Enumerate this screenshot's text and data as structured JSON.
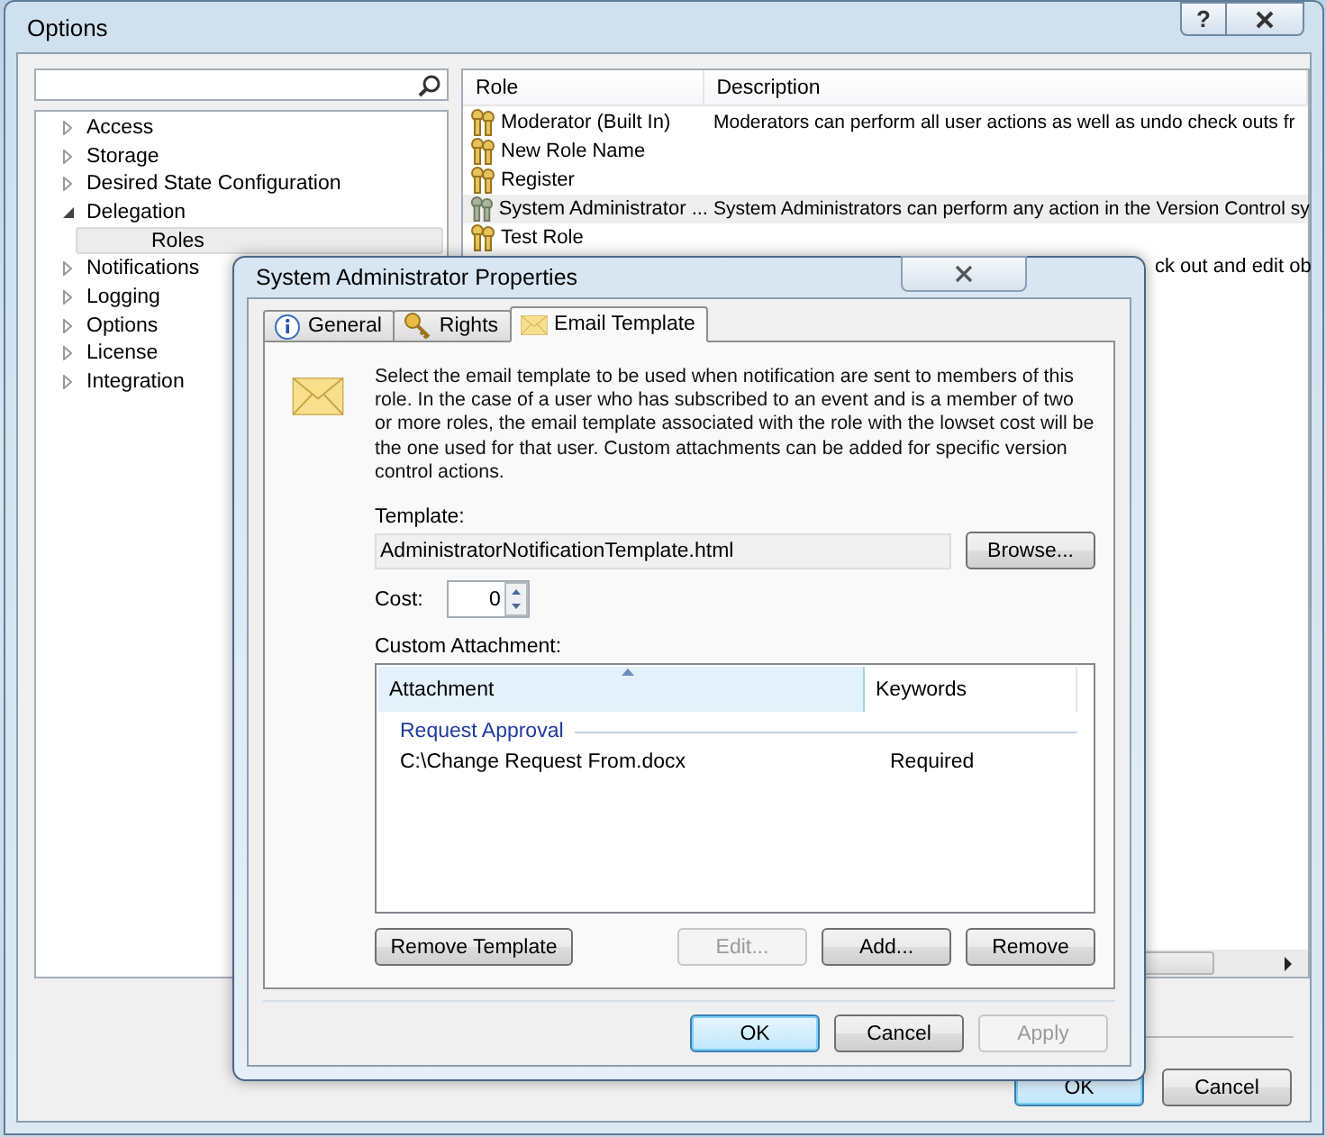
{
  "window": {
    "title": "Options",
    "help": "?"
  },
  "tree": [
    {
      "label": "Access",
      "expanded": false
    },
    {
      "label": "Storage",
      "expanded": false
    },
    {
      "label": "Desired State Configuration",
      "expanded": false
    },
    {
      "label": "Delegation",
      "expanded": true,
      "children": [
        {
          "label": "Roles",
          "selected": true
        }
      ]
    },
    {
      "label": "Notifications",
      "expanded": false
    },
    {
      "label": "Logging",
      "expanded": false
    },
    {
      "label": "Options",
      "expanded": false
    },
    {
      "label": "License",
      "expanded": false
    },
    {
      "label": "Integration",
      "expanded": false
    }
  ],
  "roles_table": {
    "columns": [
      "Role",
      "Description"
    ],
    "rows": [
      {
        "role": "Moderator (Built In)",
        "description": "Moderators can perform all user actions as well as undo check outs fr",
        "kind": "key",
        "selected": false
      },
      {
        "role": "New Role Name",
        "kind": "key",
        "selected": false
      },
      {
        "role": "Register",
        "kind": "key",
        "selected": false
      },
      {
        "role": "System Administrator ...",
        "description": "System Administrators can perform any action in the Version Control sy",
        "kind": "admin",
        "selected": true
      },
      {
        "role": "Test Role",
        "kind": "key",
        "selected": false
      },
      {
        "description": "ck out and edit ob",
        "kind": "covered",
        "selected": false
      }
    ]
  },
  "buttons": [
    {
      "label": "OK",
      "default": true
    },
    {
      "label": "Cancel",
      "default": false
    }
  ],
  "dialog": {
    "title": "System Administrator Properties",
    "tabs": [
      {
        "label": "General",
        "kind": "info",
        "selected": false
      },
      {
        "label": "Rights",
        "kind": "key",
        "selected": false
      },
      {
        "label": "Email Template",
        "kind": "envelope",
        "selected": true
      }
    ],
    "description": "Select the email template to be used when notification are sent to members of this role. In the case of a user who has subscribed to an event and is a member of two or more roles, the email template associated with the role with the lowset cost will be the one used for that user. Custom attachments can be added for specific version control actions.",
    "template_label": "Template:",
    "template_value": "AdministratorNotificationTemplate.html",
    "browse": "Browse...",
    "cost_label": "Cost:",
    "cost_value": "0",
    "attachment_label": "Custom Attachment:",
    "attachment_columns": [
      "Attachment",
      "Keywords"
    ],
    "groups": [
      {
        "name": "Request Approval",
        "rows": [
          {
            "attachment": "C:\\Change Request From.docx",
            "keywords": "Required"
          }
        ]
      }
    ],
    "list_buttons": [
      {
        "label": "Remove Template",
        "disabled": false
      },
      {
        "label": "Edit...",
        "disabled": true
      },
      {
        "label": "Add...",
        "disabled": false
      },
      {
        "label": "Remove",
        "disabled": false
      }
    ],
    "footer_buttons": [
      {
        "label": "OK",
        "disabled": false,
        "default": true
      },
      {
        "label": "Cancel",
        "disabled": false,
        "default": false
      },
      {
        "label": "Apply",
        "disabled": true,
        "default": false
      }
    ]
  }
}
